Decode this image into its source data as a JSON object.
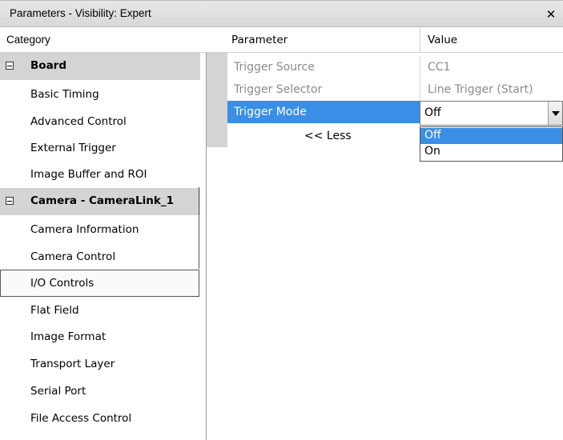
{
  "window": {
    "title": "Parameters - Visibility: Expert",
    "close_glyph": "✕"
  },
  "category": {
    "header": "Category",
    "items": [
      {
        "label": "Board",
        "type": "group"
      },
      {
        "label": "Basic Timing",
        "type": "item"
      },
      {
        "label": "Advanced Control",
        "type": "item"
      },
      {
        "label": "External Trigger",
        "type": "item"
      },
      {
        "label": "Image Buffer and ROI",
        "type": "item"
      },
      {
        "label": "Camera - CameraLink_1",
        "type": "group"
      },
      {
        "label": "Camera Information",
        "type": "item"
      },
      {
        "label": "Camera Control",
        "type": "item"
      },
      {
        "label": "I/O Controls",
        "type": "item",
        "selected": true
      },
      {
        "label": "Flat Field",
        "type": "item"
      },
      {
        "label": "Image Format",
        "type": "item"
      },
      {
        "label": "Transport Layer",
        "type": "item"
      },
      {
        "label": "Serial Port",
        "type": "item"
      },
      {
        "label": "File Access Control",
        "type": "item"
      }
    ]
  },
  "params": {
    "header_parameter": "Parameter",
    "header_value": "Value",
    "rows": [
      {
        "name": "Trigger Source",
        "value": "CC1"
      },
      {
        "name": "Trigger Selector",
        "value": "Line Trigger (Start)"
      },
      {
        "name": "Trigger Mode",
        "value": "Off"
      }
    ],
    "less_label": "<< Less"
  },
  "dropdown": {
    "selected": "Off",
    "options": [
      "Off",
      "On"
    ]
  },
  "colors": {
    "selection": "#3a8ee6",
    "group_bg": "#d4d4d4"
  }
}
